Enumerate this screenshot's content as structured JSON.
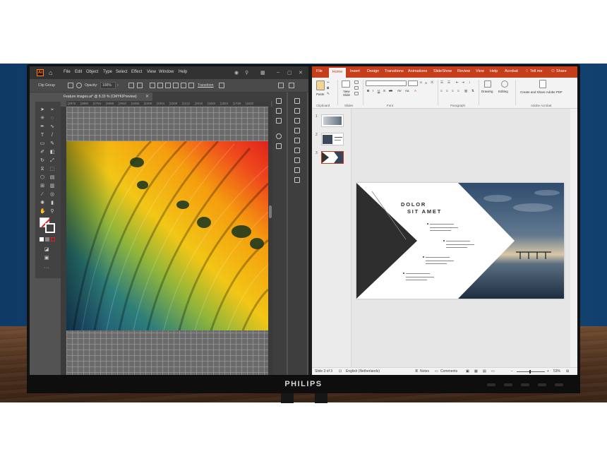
{
  "brand": "PHILIPS",
  "illustrator": {
    "menu": [
      "File",
      "Edit",
      "Object",
      "Type",
      "Select",
      "Effect",
      "View",
      "Window",
      "Help"
    ],
    "control_bar": {
      "selection": "Clip Group",
      "opacity_label": "Opacity:",
      "opacity_value": "100%",
      "transform_label": "Transform"
    },
    "document_tab": "Feature images.ai* @ 8.33 % (CMYK/Preview)",
    "ruler_ticks": [
      "|2976",
      "|2880",
      "|2784",
      "|2688",
      "|2592",
      "|2496",
      "|2400",
      "|2304",
      "|2208",
      "|2112",
      "|2016",
      "|1920",
      "|1824",
      "|1728",
      "|1632"
    ],
    "colors": {
      "accent": "#ff8a00",
      "ui_dark": "#323232",
      "ui_mid": "#535353"
    }
  },
  "powerpoint": {
    "tabs": [
      "File",
      "Home",
      "Insert",
      "Design",
      "Transitions",
      "Animations",
      "SlideShow",
      "Review",
      "View",
      "Help",
      "Acrobat"
    ],
    "tell_me": "Tell me",
    "share": "Share",
    "ribbon": {
      "paste_label": "Paste",
      "new_slide_label": "New Slide",
      "drawing_label": "Drawing",
      "editing_label": "Editing",
      "acrobat_label": "Create and Share Adobe PDF",
      "groups": [
        "Clipboard",
        "Slides",
        "Font",
        "Paragraph",
        "Adobe Acrobat"
      ]
    },
    "slide_numbers": [
      "1",
      "2",
      "3"
    ],
    "slide": {
      "title_line1": "DOLOR",
      "title_line2": "SIT AMET"
    },
    "status": {
      "slide_counter": "Slide 3 of 3",
      "language": "English (Netherlands)",
      "notes": "Notes",
      "comments": "Comments",
      "zoom": "53%"
    },
    "colors": {
      "accent": "#c43e1c"
    }
  }
}
